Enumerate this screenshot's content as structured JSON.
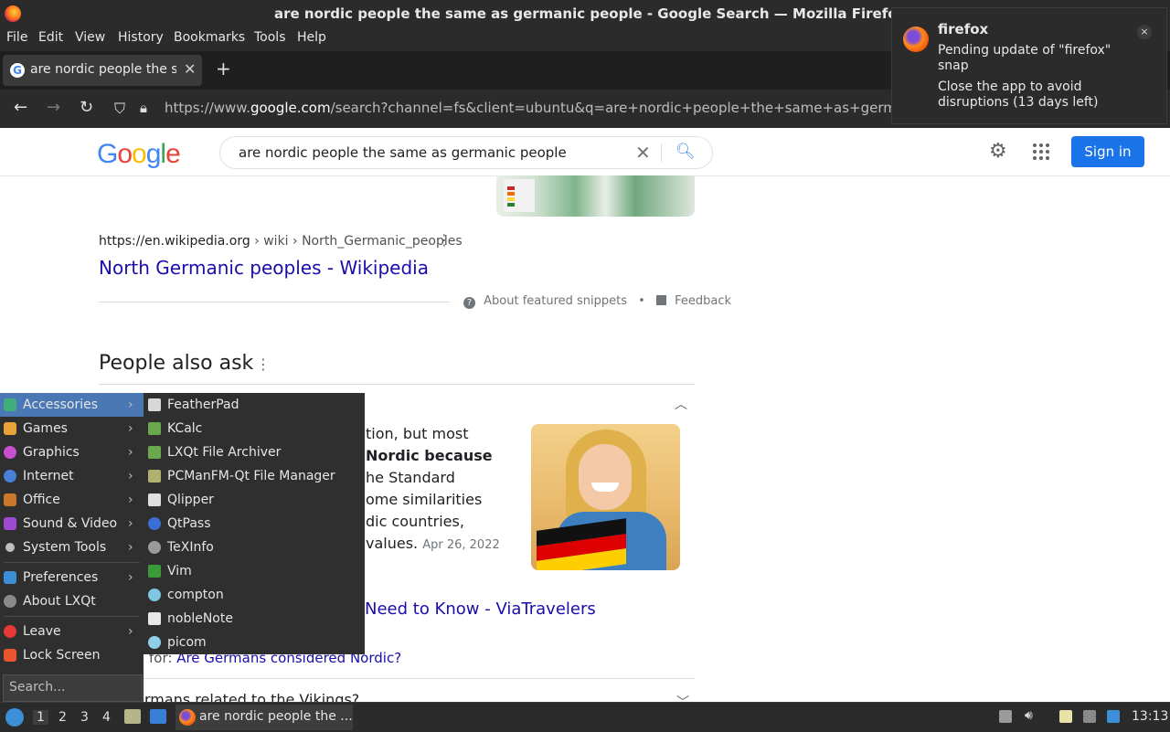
{
  "window": {
    "title": "are nordic people the same as germanic people - Google Search — Mozilla Firefox"
  },
  "menubar": {
    "items": [
      "File",
      "Edit",
      "View",
      "History",
      "Bookmarks",
      "Tools",
      "Help"
    ]
  },
  "tabs": [
    {
      "label": "are nordic people the same as germanic people - Google Search"
    }
  ],
  "addressbar": {
    "url_prefix": "https://www.",
    "url_domain": "google.com",
    "url_rest": "/search?channel=fs&client=ubuntu&q=are+nordic+people+the+same+as+germanic+p"
  },
  "notification": {
    "app": "firefox",
    "line1": "Pending update of \"firefox\" snap",
    "line2": "Close the app to avoid disruptions (13 days left)",
    "close": "×"
  },
  "google": {
    "logo": "Google",
    "query": "are nordic people the same as germanic people",
    "signin_label": "Sign in"
  },
  "result": {
    "cite_domain": "https://en.wikipedia.org",
    "cite_path": " › wiki › North_Germanic_peoples",
    "title": "North Germanic peoples - Wikipedia",
    "about_snippets": "About featured snippets",
    "feedback": "Feedback",
    "dot": "•"
  },
  "paa": {
    "heading": "People also ask",
    "snippet_lines": [
      "tion, but most",
      "Nordic because",
      "he Standard",
      "ome similarities",
      "dic countries,",
      "values."
    ],
    "snippet_date": "Apr 26, 2022",
    "answer_link": "Need to Know - ViaTravelers",
    "search_for_prefix": "for: ",
    "search_for_link": "Are Germans considered Nordic?",
    "next_question": "rmans related to the Vikings?"
  },
  "lxqt_menu": {
    "categories": [
      {
        "label": "Accessories",
        "color": "#3fae7a"
      },
      {
        "label": "Games",
        "color": "#e8a33a"
      },
      {
        "label": "Graphics",
        "color": "#c74fd0"
      },
      {
        "label": "Internet",
        "color": "#4a7fd6"
      },
      {
        "label": "Office",
        "color": "#c9772b"
      },
      {
        "label": "Sound & Video",
        "color": "#9c4bd0"
      },
      {
        "label": "System Tools",
        "color": "#bfbfbf"
      }
    ],
    "preferences": "Preferences",
    "about": "About LXQt",
    "leave": "Leave",
    "lock_screen": "Lock Screen",
    "search_placeholder": "Search...",
    "submenu": [
      {
        "label": "FeatherPad",
        "color": "#d8d8d8"
      },
      {
        "label": "KCalc",
        "color": "#6aa84f"
      },
      {
        "label": "LXQt File Archiver",
        "color": "#6aa84f"
      },
      {
        "label": "PCManFM-Qt File Manager",
        "color": "#b0b070"
      },
      {
        "label": "Qlipper",
        "color": "#e0e0e0"
      },
      {
        "label": "QtPass",
        "color": "#3a6fd6"
      },
      {
        "label": "TeXInfo",
        "color": "#9a9a9a"
      },
      {
        "label": "Vim",
        "color": "#3a9a3a"
      },
      {
        "label": "compton",
        "color": "#7fc7e0"
      },
      {
        "label": "nobleNote",
        "color": "#e8e8e8"
      },
      {
        "label": "picom",
        "color": "#8fd0e8"
      }
    ]
  },
  "taskbar": {
    "workspaces": [
      "1",
      "2",
      "3",
      "4"
    ],
    "task_label": "are nordic people the ...",
    "clock": "13:13"
  }
}
